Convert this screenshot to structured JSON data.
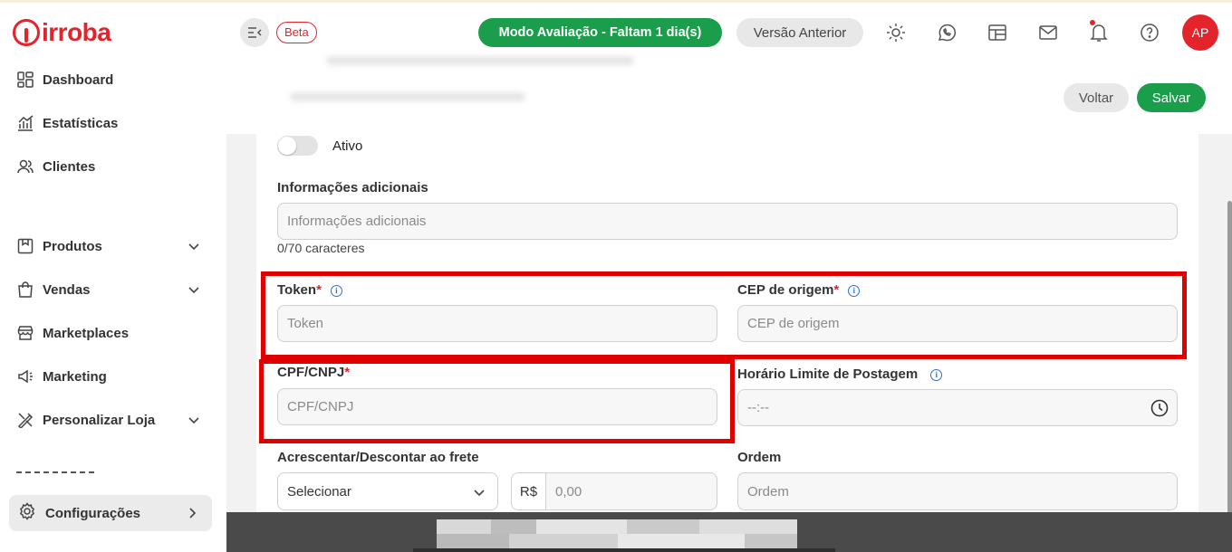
{
  "brand": {
    "name": "irroba",
    "color": "#e3242b"
  },
  "sidebar": {
    "items": [
      {
        "label": "Dashboard",
        "icon": "dashboard-icon"
      },
      {
        "label": "Estatísticas",
        "icon": "stats-icon"
      },
      {
        "label": "Clientes",
        "icon": "users-icon"
      },
      {
        "label": "Produtos",
        "icon": "box-icon"
      },
      {
        "label": "Vendas",
        "icon": "bag-icon"
      },
      {
        "label": "Marketplaces",
        "icon": "store-icon"
      },
      {
        "label": "Marketing",
        "icon": "megaphone-icon"
      },
      {
        "label": "Personalizar Loja",
        "icon": "brush-icon"
      }
    ],
    "config": {
      "label": "Configurações",
      "icon": "gear-icon"
    }
  },
  "header": {
    "beta": "Beta",
    "trial": "Modo Avaliação - Faltam 1 dia(s)",
    "previous_version": "Versão Anterior",
    "avatar": "AP",
    "icons": [
      "sun-icon",
      "whatsapp-icon",
      "calendar-icon",
      "mail-icon",
      "bell-icon",
      "help-icon"
    ]
  },
  "actions": {
    "back": "Voltar",
    "save": "Salvar"
  },
  "form": {
    "active": {
      "label": "Ativo",
      "checked": false
    },
    "additional_info": {
      "label": "Informações adicionais",
      "placeholder": "Informações adicionais",
      "counter": "0/70 caracteres"
    },
    "token": {
      "label": "Token",
      "required": "*",
      "placeholder": "Token"
    },
    "cep": {
      "label": "CEP de origem",
      "required": "*",
      "placeholder": "CEP de origem"
    },
    "cpf": {
      "label": "CPF/CNPJ",
      "required": "*",
      "placeholder": "CPF/CNPJ"
    },
    "postage_time": {
      "label": "Horário Limite de Postagem",
      "placeholder": "--:--"
    },
    "freight": {
      "label": "Acrescentar/Descontar ao frete",
      "selected": "Selecionar",
      "currency": "R$",
      "amount_placeholder": "0,00"
    },
    "order": {
      "label": "Ordem",
      "placeholder": "Ordem"
    }
  },
  "colors": {
    "accent_green": "#1a9e4b",
    "highlight_red": "#e00000"
  }
}
